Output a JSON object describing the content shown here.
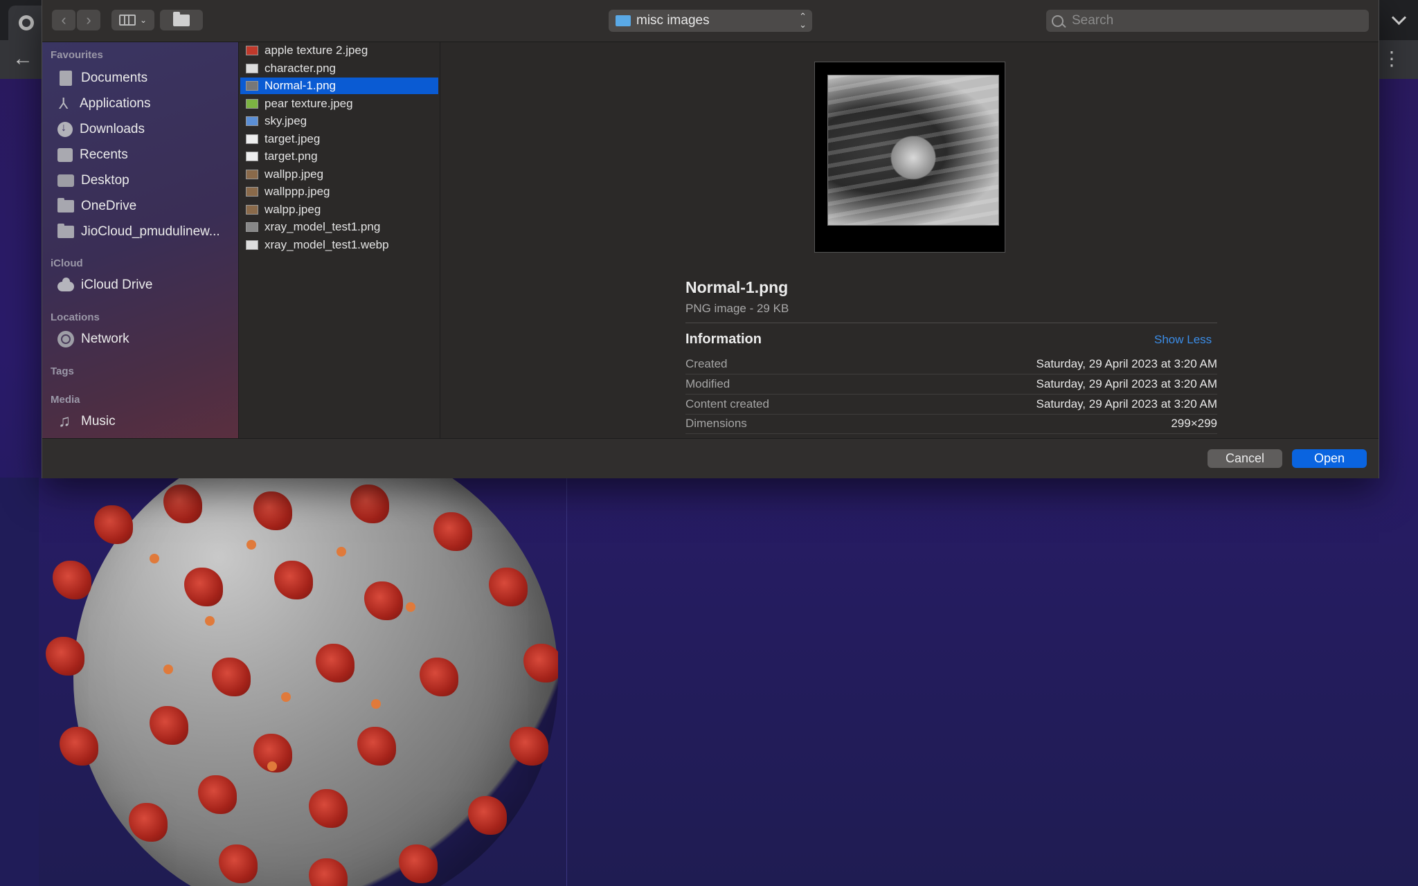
{
  "dialog": {
    "location": "misc images",
    "search_placeholder": "Search"
  },
  "sidebar": {
    "sections": {
      "favourites": "Favourites",
      "icloud": "iCloud",
      "locations": "Locations",
      "tags": "Tags",
      "media": "Media"
    },
    "favourites": [
      {
        "label": "Documents",
        "icon": "document-icon"
      },
      {
        "label": "Applications",
        "icon": "applications-icon"
      },
      {
        "label": "Downloads",
        "icon": "download-icon"
      },
      {
        "label": "Recents",
        "icon": "recents-icon"
      },
      {
        "label": "Desktop",
        "icon": "desktop-icon"
      },
      {
        "label": "OneDrive",
        "icon": "folder-icon"
      },
      {
        "label": "JioCloud_pmudulinew...",
        "icon": "folder-icon"
      }
    ],
    "icloud": [
      {
        "label": "iCloud Drive",
        "icon": "cloud-icon"
      }
    ],
    "locations": [
      {
        "label": "Network",
        "icon": "network-icon"
      }
    ],
    "media": [
      {
        "label": "Music",
        "icon": "music-icon"
      }
    ]
  },
  "files": [
    {
      "name": "apple texture 2.jpeg",
      "icon_color": "#c0392b"
    },
    {
      "name": "character.png",
      "icon_color": "#dddddd"
    },
    {
      "name": "Normal-1.png",
      "icon_color": "#777777",
      "selected": true
    },
    {
      "name": "pear texture.jpeg",
      "icon_color": "#7cb342"
    },
    {
      "name": "sky.jpeg",
      "icon_color": "#5b8fd6"
    },
    {
      "name": "target.jpeg",
      "icon_color": "#eeeeee"
    },
    {
      "name": "target.png",
      "icon_color": "#eeeeee"
    },
    {
      "name": "wallpp.jpeg",
      "icon_color": "#8a6a4a"
    },
    {
      "name": "wallppp.jpeg",
      "icon_color": "#8a6a4a"
    },
    {
      "name": "walpp.jpeg",
      "icon_color": "#8a6a4a"
    },
    {
      "name": "xray_model_test1.png",
      "icon_color": "#888888"
    },
    {
      "name": "xray_model_test1.webp",
      "icon_color": "#dddddd"
    }
  ],
  "preview": {
    "file_name": "Normal-1.png",
    "file_kind": "PNG image - 29 KB",
    "info_title": "Information",
    "show_less": "Show Less",
    "info": [
      {
        "key": "Created",
        "value": "Saturday, 29 April 2023 at 3:20 AM"
      },
      {
        "key": "Modified",
        "value": "Saturday, 29 April 2023 at 3:20 AM"
      },
      {
        "key": "Content created",
        "value": "Saturday, 29 April 2023 at 3:20 AM"
      },
      {
        "key": "Dimensions",
        "value": "299×299"
      }
    ]
  },
  "footer": {
    "cancel": "Cancel",
    "open": "Open"
  },
  "colors": {
    "accent": "#0a64e0",
    "selection": "#0a5bd3",
    "link": "#3b8de8"
  }
}
